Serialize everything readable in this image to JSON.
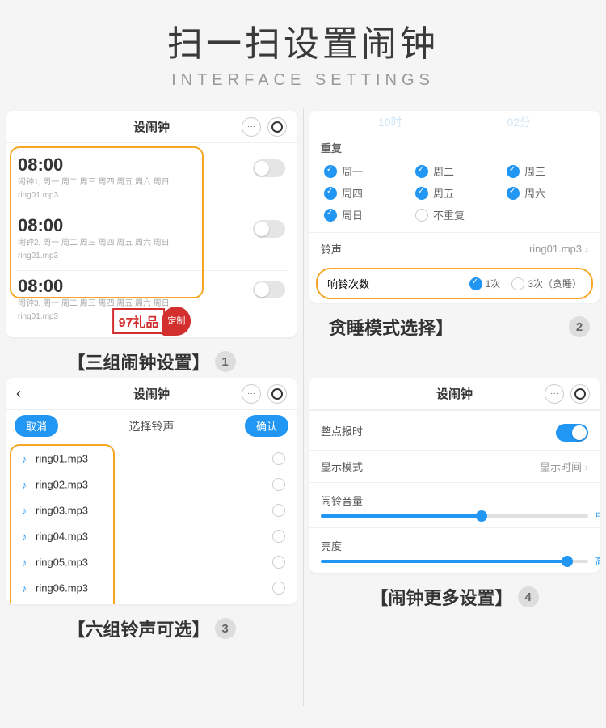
{
  "header": {
    "title": "扫一扫设置闹钟",
    "subtitle": "INTERFACE  SETTINGS"
  },
  "watermark": {
    "box": "97礼品",
    "seal": "定制"
  },
  "panel1": {
    "title": "设闹钟",
    "alarms": [
      {
        "time": "08:00",
        "days": "闹钟1, 周一 周二 周三 周四 周五 周六 周日",
        "ring": "ring01.mp3"
      },
      {
        "time": "08:00",
        "days": "闹钟2, 周一 周二 周三 周四 周五 周六 周日",
        "ring": "ring01.mp3"
      },
      {
        "time": "08:00",
        "days": "闹钟3, 周一 周二 周三 周四 周五 周六 周日",
        "ring": "ring01.mp3"
      }
    ],
    "caption": "【三组闹钟设置】",
    "num": "1"
  },
  "panel2": {
    "picker": {
      "hour": "10时",
      "minute": "02分"
    },
    "repeat_label": "重复",
    "days": [
      "周一",
      "周二",
      "周三",
      "周四",
      "周五",
      "周六",
      "周日",
      "不重复"
    ],
    "ring_label": "铃声",
    "ring_value": "ring01.mp3",
    "count_label": "响铃次数",
    "count_opts": [
      "1次",
      "3次（贪睡）"
    ],
    "caption": "贪睡模式选择】",
    "num": "2"
  },
  "panel3": {
    "title": "设闹钟",
    "subtitle": "选择铃声",
    "cancel": "取消",
    "confirm": "确认",
    "rings": [
      "ring01.mp3",
      "ring02.mp3",
      "ring03.mp3",
      "ring04.mp3",
      "ring05.mp3",
      "ring06.mp3"
    ],
    "caption": "【六组铃声可选】",
    "num": "3"
  },
  "panel4": {
    "title": "设闹钟",
    "chime_label": "整点报时",
    "display_label": "显示模式",
    "display_value": "显示时间",
    "volume_label": "闹铃音量",
    "volume_tag": "中",
    "bright_label": "亮度",
    "bright_tag": "高",
    "caption": "【闹钟更多设置】",
    "num": "4"
  }
}
